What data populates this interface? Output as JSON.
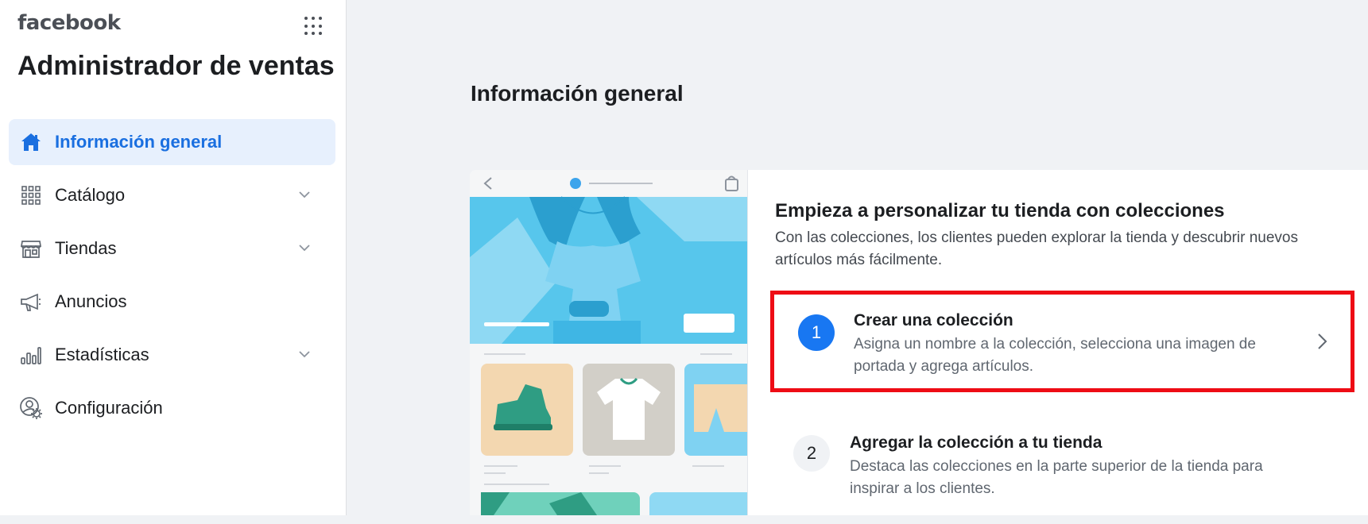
{
  "brand": "facebook",
  "app_title": "Administrador de ventas",
  "sidebar": {
    "items": [
      {
        "label": "Información general",
        "icon": "home-icon"
      },
      {
        "label": "Catálogo",
        "icon": "grid-icon"
      },
      {
        "label": "Tiendas",
        "icon": "store-icon"
      },
      {
        "label": "Anuncios",
        "icon": "megaphone-icon"
      },
      {
        "label": "Estadísticas",
        "icon": "bar-chart-icon"
      },
      {
        "label": "Configuración",
        "icon": "settings-icon"
      }
    ]
  },
  "main": {
    "title": "Información general",
    "card": {
      "title": "Empieza a personalizar tu tienda con colecciones",
      "description": "Con las colecciones, los clientes pueden explorar la tienda y descubrir nuevos artículos más fácilmente.",
      "steps": [
        {
          "number": "1",
          "title": "Crear una colección",
          "description": "Asigna un nombre a la colección, selecciona una imagen de portada y agrega artículos."
        },
        {
          "number": "2",
          "title": "Agregar la colección a tu tienda",
          "description": "Destaca las colecciones en la parte superior de la tienda para inspirar a los clientes."
        }
      ]
    }
  },
  "colors": {
    "accent": "#1877f2",
    "active_bg": "#e7f0fd",
    "highlight_border": "#ee0c15"
  }
}
